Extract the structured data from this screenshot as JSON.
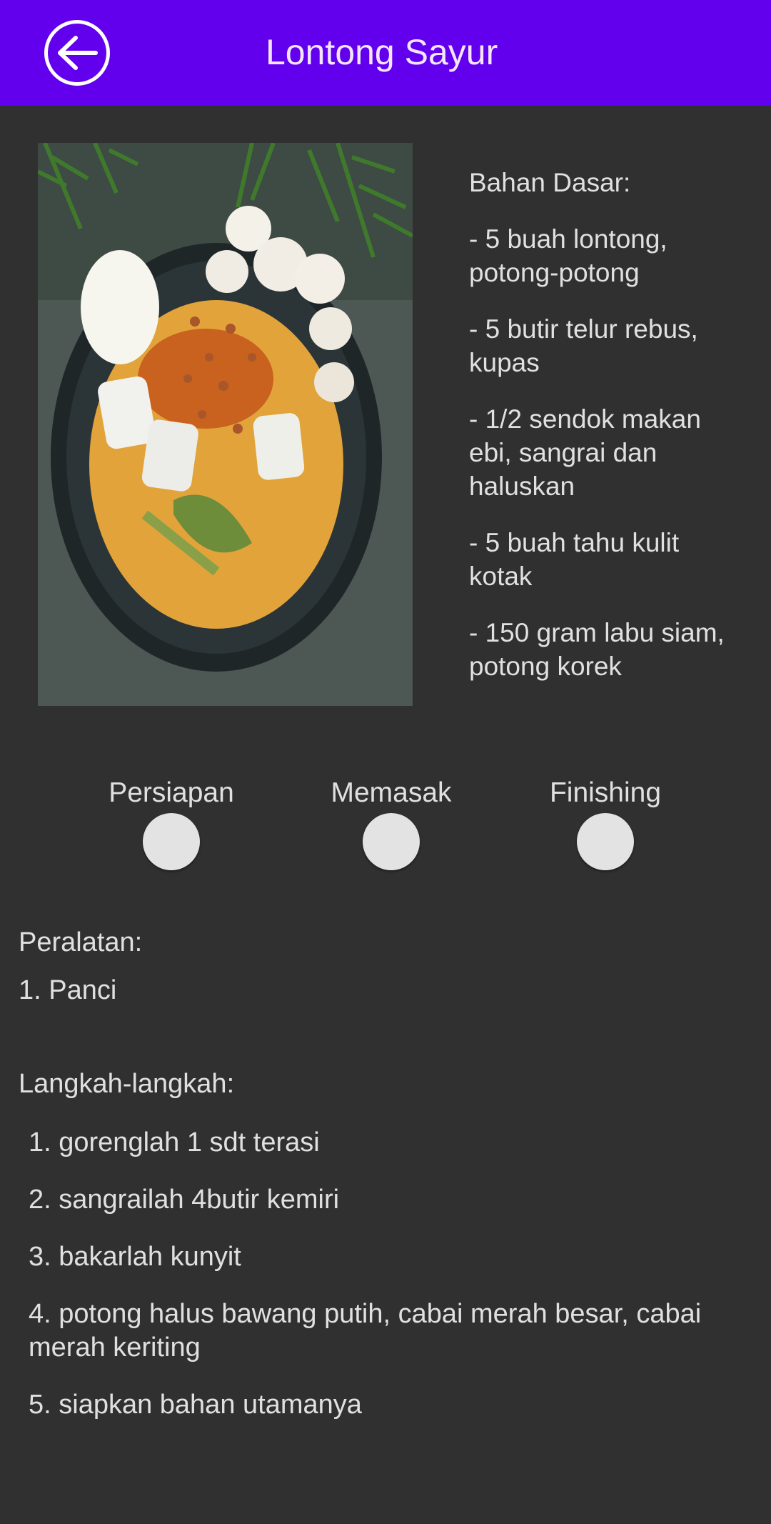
{
  "appbar": {
    "title": "Lontong Sayur",
    "back_icon": "arrow-left-circle-icon",
    "background": "#6200ee"
  },
  "image": {
    "subject": "lontong-sayur-dish-photo"
  },
  "ingredients": {
    "title": "Bahan Dasar:",
    "items": [
      "- 5 buah lontong, potong-potong",
      "- 5 butir telur rebus, kupas",
      "- 1/2 sendok makan ebi, sangrai dan haluskan",
      "- 5 buah tahu kulit kotak",
      "- 150 gram labu siam, potong korek"
    ]
  },
  "steps": [
    {
      "label": "Persiapan"
    },
    {
      "label": "Memasak"
    },
    {
      "label": "Finishing"
    }
  ],
  "equipment": {
    "title": "Peralatan:",
    "items": [
      "1. Panci"
    ]
  },
  "instructions": {
    "title": "Langkah-langkah:",
    "items": [
      "1. gorenglah 1 sdt terasi",
      "2. sangrailah 4butir kemiri",
      "3. bakarlah kunyit",
      "4. potong halus bawang putih, cabai merah besar, cabai merah keriting",
      "5. siapkan bahan utamanya"
    ]
  },
  "colors": {
    "background": "#303030",
    "text": "#e0e0e0",
    "step_dot": "#e3e3e3"
  }
}
